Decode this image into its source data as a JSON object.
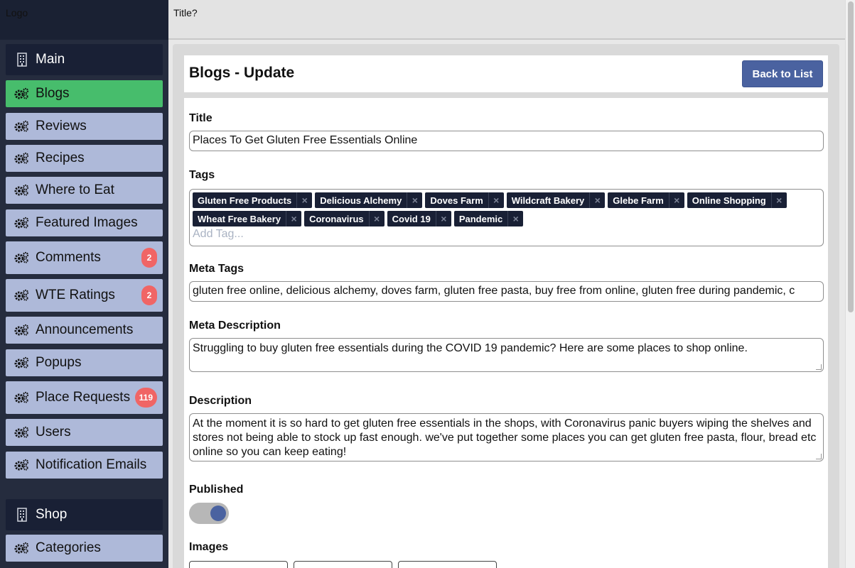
{
  "sidebar": {
    "logo": "Logo",
    "items": [
      {
        "label": "Main",
        "style": "dark",
        "icon": "building-icon"
      },
      {
        "label": "Blogs",
        "style": "active",
        "icon": "gears-icon"
      },
      {
        "label": "Reviews",
        "style": "light",
        "icon": "gears-icon"
      },
      {
        "label": "Recipes",
        "style": "light",
        "icon": "gears-icon"
      },
      {
        "label": "Where to Eat",
        "style": "light",
        "icon": "gears-icon"
      },
      {
        "label": "Featured Images",
        "style": "light",
        "icon": "gears-icon"
      },
      {
        "label": "Comments",
        "style": "light",
        "icon": "gears-icon",
        "badge": "2"
      },
      {
        "label": "WTE Ratings",
        "style": "light",
        "icon": "gears-icon",
        "badge": "2"
      },
      {
        "label": "Announcements",
        "style": "light",
        "icon": "gears-icon"
      },
      {
        "label": "Popups",
        "style": "light",
        "icon": "gears-icon"
      },
      {
        "label": "Place Requests",
        "style": "light",
        "icon": "gears-icon",
        "badge": "119"
      },
      {
        "label": "Users",
        "style": "light",
        "icon": "gears-icon"
      },
      {
        "label": "Notification Emails",
        "style": "light",
        "icon": "gears-icon"
      },
      {
        "label": "Shop",
        "style": "dark",
        "icon": "building-icon"
      },
      {
        "label": "Categories",
        "style": "light",
        "icon": "gears-icon"
      }
    ]
  },
  "header": {
    "title": "Title?"
  },
  "page": {
    "heading": "Blogs - Update",
    "back_label": "Back to List"
  },
  "form": {
    "title_label": "Title",
    "title_value": "Places To Get Gluten Free Essentials Online",
    "tags_label": "Tags",
    "tags_row1": [
      "Gluten Free Products",
      "Delicious Alchemy",
      "Doves Farm",
      "Wildcraft Bakery",
      "Glebe Farm",
      "Online Shopping"
    ],
    "tags_row2": [
      "Wheat Free Bakery",
      "Coronavirus",
      "Covid 19",
      "Pandemic"
    ],
    "tag_remove_glyph": "×",
    "add_tag_placeholder": "Add Tag...",
    "meta_tags_label": "Meta Tags",
    "meta_tags_value": "gluten free online, delicious alchemy, doves farm, gluten free pasta, buy free from online, gluten free during pandemic, c",
    "meta_desc_label": "Meta Description",
    "meta_desc_value": "Struggling to buy gluten free essentials during the COVID 19 pandemic? Here are some places to shop online.",
    "desc_label": "Description",
    "desc_value": "At the moment it is so hard to get gluten free essentials in the shops, with Coronavirus panic buyers wiping the shelves and stores not being able to stock up fast enough. we've put together some places you can get gluten free pasta, flour, bread etc online so you can keep eating!",
    "published_label": "Published",
    "published_on": true,
    "images_label": "Images"
  },
  "colors": {
    "sidebar_bg": "#252c3e",
    "nav_light": "#aeb9d9",
    "nav_active": "#47bd6c",
    "nav_dark": "#192035",
    "badge": "#f06565",
    "primary": "#4a62a0",
    "tag_bg": "#192035"
  }
}
